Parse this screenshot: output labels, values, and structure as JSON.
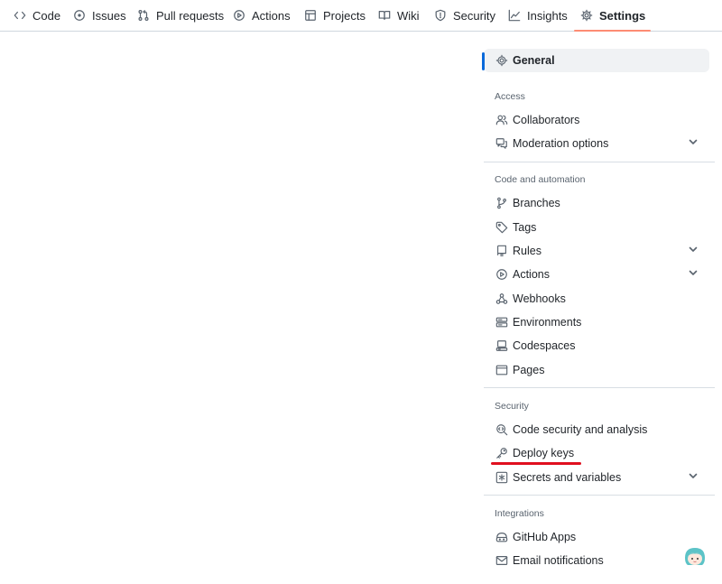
{
  "nav": {
    "tabs": [
      {
        "label": "Code",
        "icon": "code-icon"
      },
      {
        "label": "Issues",
        "icon": "issue-icon"
      },
      {
        "label": "Pull requests",
        "icon": "pull-request-icon"
      },
      {
        "label": "Actions",
        "icon": "play-icon"
      },
      {
        "label": "Projects",
        "icon": "table-icon"
      },
      {
        "label": "Wiki",
        "icon": "book-icon"
      },
      {
        "label": "Security",
        "icon": "shield-icon"
      },
      {
        "label": "Insights",
        "icon": "graph-icon"
      },
      {
        "label": "Settings",
        "icon": "gear-icon",
        "active": true
      }
    ]
  },
  "sidebar": {
    "general": "General",
    "sections": {
      "access": "Access",
      "code_automation": "Code and automation",
      "security": "Security",
      "integrations": "Integrations"
    },
    "access_items": [
      "Collaborators",
      "Moderation options"
    ],
    "code_items": [
      "Branches",
      "Tags",
      "Rules",
      "Actions",
      "Webhooks",
      "Environments",
      "Codespaces",
      "Pages"
    ],
    "security_items": [
      "Code security and analysis",
      "Deploy keys",
      "Secrets and variables"
    ],
    "integration_items": [
      "GitHub Apps",
      "Email notifications"
    ]
  },
  "colors": {
    "active_tab_underline": "#fd8c73",
    "selected_marker": "#0969da",
    "annotation_underline": "#e0101f"
  }
}
